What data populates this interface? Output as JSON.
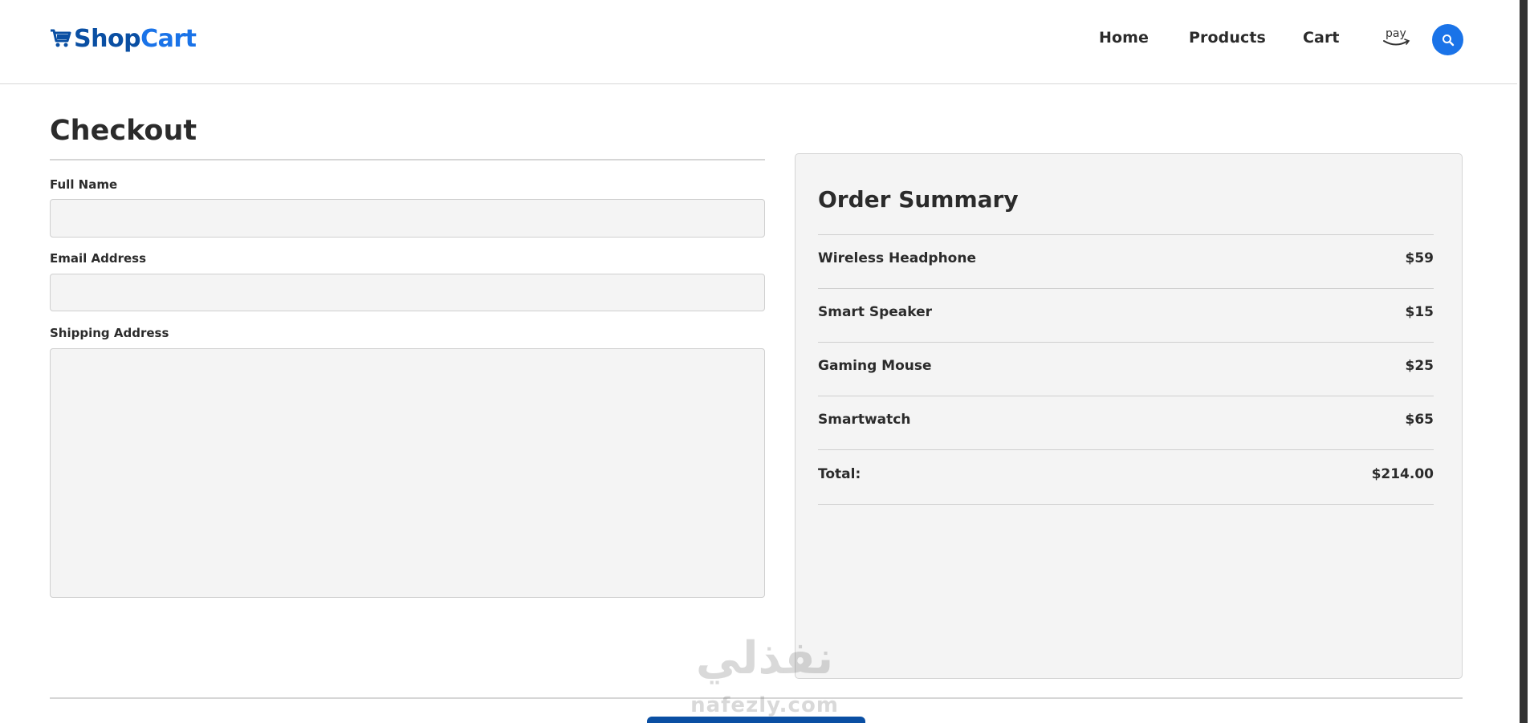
{
  "header": {
    "logo": {
      "part1": "Shop",
      "part2": "Cart"
    },
    "nav": [
      {
        "label": "Home"
      },
      {
        "label": "Products"
      },
      {
        "label": "Cart"
      }
    ],
    "pay_icon_label": "pay",
    "search_icon": "search-icon"
  },
  "checkout": {
    "title": "Checkout",
    "fields": {
      "full_name": {
        "label": "Full Name",
        "value": ""
      },
      "email": {
        "label": "Email Address",
        "value": ""
      },
      "address": {
        "label": "Shipping Address",
        "value": ""
      }
    }
  },
  "summary": {
    "title": "Order Summary",
    "items": [
      {
        "name": "Wireless Headphone",
        "price": "$59"
      },
      {
        "name": "Smart Speaker",
        "price": "$15"
      },
      {
        "name": "Gaming Mouse",
        "price": "$25"
      },
      {
        "name": "Smartwatch",
        "price": "$65"
      }
    ],
    "total_label": "Total:",
    "total_value": "$214.00"
  },
  "watermark": {
    "arabic": "نفذلي",
    "latin": "nafezly.com"
  },
  "colors": {
    "brand_dark": "#0a4fa3",
    "brand_light": "#1a73e8",
    "panel_bg": "#f4f4f4"
  }
}
